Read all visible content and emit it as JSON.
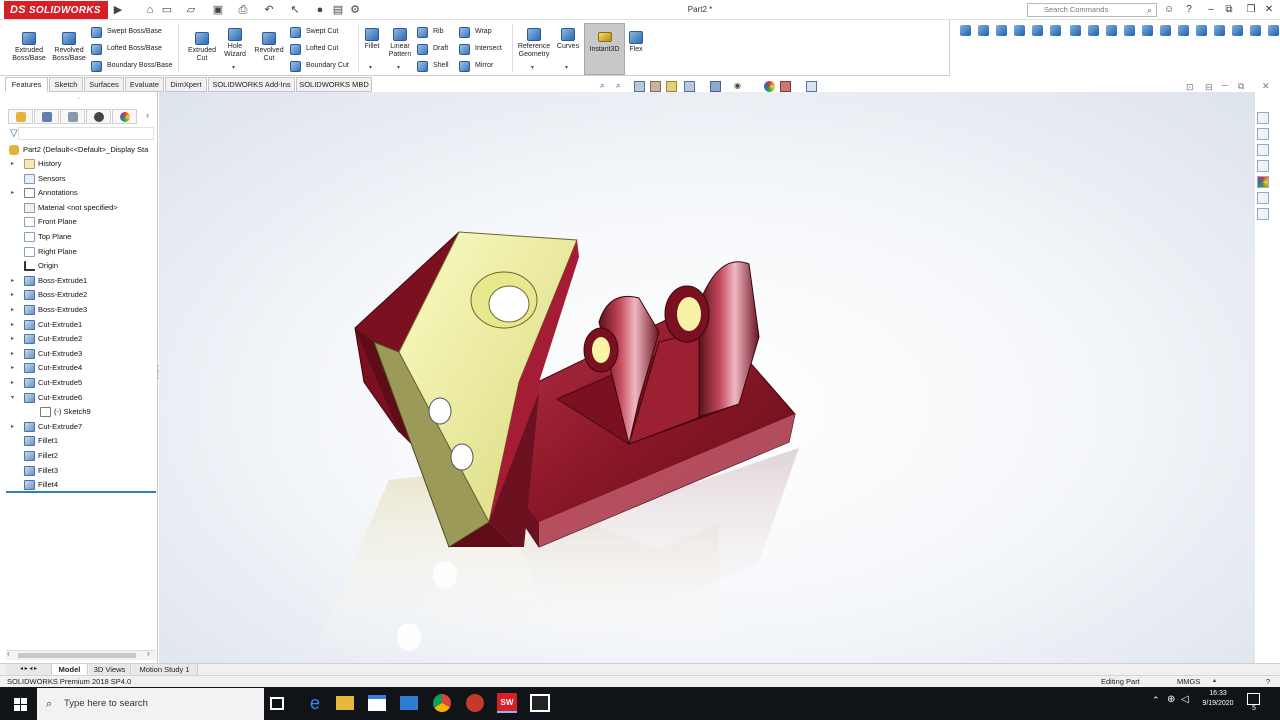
{
  "app": {
    "logo": "SOLIDWORKS",
    "logo_mark": "DS",
    "doc_title": "Part2 *",
    "search_placeholder": "Search Commands"
  },
  "ribbon": {
    "extruded_boss": "Extruded Boss/Base",
    "revolved_boss": "Revolved Boss/Base",
    "swept_boss": "Swept Boss/Base",
    "lofted_boss": "Lofted Boss/Base",
    "boundary_boss": "Boundary Boss/Base",
    "extruded_cut": "Extruded Cut",
    "hole_wizard": "Hole Wizard",
    "revolved_cut": "Revolved Cut",
    "swept_cut": "Swept Cut",
    "lofted_cut": "Lofted Cut",
    "boundary_cut": "Boundary Cut",
    "fillet": "Fillet",
    "linear_pattern": "Linear Pattern",
    "rib": "Rib",
    "draft": "Draft",
    "shell": "Shell",
    "wrap": "Wrap",
    "intersect": "Intersect",
    "mirror": "Mirror",
    "reference_geometry": "Reference Geometry",
    "curves": "Curves",
    "instant3d": "Instant3D",
    "flex": "Flex"
  },
  "tabs": [
    "Features",
    "Sketch",
    "Surfaces",
    "Evaluate",
    "DimXpert",
    "SOLIDWORKS Add-Ins",
    "SOLIDWORKS MBD"
  ],
  "tree": {
    "root": "Part2  (Default<<Default>_Display Sta",
    "items": [
      {
        "label": "History",
        "icon": "fold",
        "expand": true
      },
      {
        "label": "Sensors",
        "icon": "sens",
        "expand": false
      },
      {
        "label": "Annotations",
        "icon": "ann",
        "expand": true
      },
      {
        "label": "Material <not specified>",
        "icon": "mat",
        "expand": false
      },
      {
        "label": "Front Plane",
        "icon": "plane",
        "expand": false
      },
      {
        "label": "Top Plane",
        "icon": "plane",
        "expand": false
      },
      {
        "label": "Right Plane",
        "icon": "plane",
        "expand": false
      },
      {
        "label": "Origin",
        "icon": "origin",
        "expand": false
      },
      {
        "label": "Boss-Extrude1",
        "icon": "feat",
        "expand": true
      },
      {
        "label": "Boss-Extrude2",
        "icon": "feat",
        "expand": true
      },
      {
        "label": "Boss-Extrude3",
        "icon": "feat",
        "expand": true
      },
      {
        "label": "Cut-Extrude1",
        "icon": "feat",
        "expand": true
      },
      {
        "label": "Cut-Extrude2",
        "icon": "feat",
        "expand": true
      },
      {
        "label": "Cut-Extrude3",
        "icon": "feat",
        "expand": true
      },
      {
        "label": "Cut-Extrude4",
        "icon": "feat",
        "expand": true
      },
      {
        "label": "Cut-Extrude5",
        "icon": "feat",
        "expand": true
      },
      {
        "label": "Cut-Extrude6",
        "icon": "feat",
        "expand": "open"
      },
      {
        "label": "(-) Sketch9",
        "icon": "sk",
        "expand": false,
        "child": true
      },
      {
        "label": "Cut-Extrude7",
        "icon": "feat",
        "expand": true
      },
      {
        "label": "Fillet1",
        "icon": "feat",
        "expand": false
      },
      {
        "label": "Fillet2",
        "icon": "feat",
        "expand": false
      },
      {
        "label": "Fillet3",
        "icon": "feat",
        "expand": false
      },
      {
        "label": "Fillet4",
        "icon": "feat",
        "expand": false
      }
    ]
  },
  "bottom_tabs": [
    "Model",
    "3D Views",
    "Motion Study 1"
  ],
  "status": {
    "product": "SOLIDWORKS Premium 2018 SP4.0",
    "mode": "Editing Part",
    "units": "MMGS"
  },
  "taskbar": {
    "search": "Type here to search",
    "time": "16:33",
    "date": "9/19/2020",
    "notifications": "5"
  },
  "colors": {
    "part_body": "#8a1726",
    "part_face_yellow": "#eaea9a",
    "logo_red": "#d81f26",
    "selection_blue": "#2f7fc0"
  }
}
